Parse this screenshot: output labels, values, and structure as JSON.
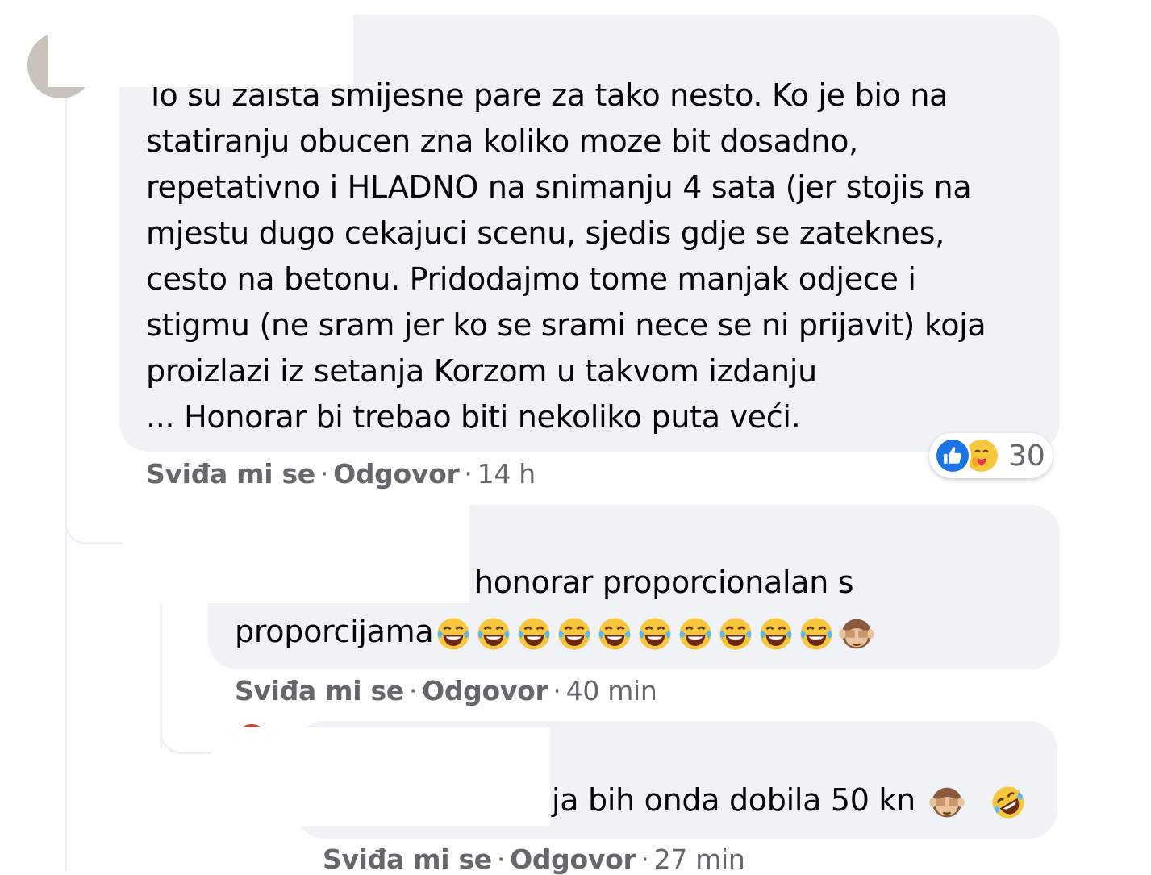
{
  "comment": {
    "lines": [
      "To su zaista smijesne pare za tako nesto. Ko je bio na",
      "statiranju obucen zna koliko moze bit dosadno,",
      "repetativno i HLADNO na snimanju 4 sata (jer stojis na",
      "mjestu dugo cekajuci scenu, sjedis gdje se zateknes,",
      "cesto na betonu. Pridodajmo tome manjak odjece i",
      "stigmu (ne sram jer ko se srami nece se ni prijavit) koja",
      "proizlazi iz setanja Korzom u takvom izdanju",
      "... Honorar bi trebao biti nekoliko puta veći."
    ],
    "like_label": "Sviđa mi se",
    "reply_label": "Odgovor",
    "separator": "·",
    "time": "14 h",
    "reactions": {
      "icons": [
        "like-icon",
        "care-icon"
      ],
      "count": "30"
    }
  },
  "reply1": {
    "line1": "honorar proporcionalan s",
    "line2": "proporcijama",
    "emojis": [
      "laughing-crying-emoji",
      "laughing-crying-emoji",
      "laughing-crying-emoji",
      "laughing-crying-emoji",
      "laughing-crying-emoji",
      "laughing-crying-emoji",
      "laughing-crying-emoji",
      "laughing-crying-emoji",
      "laughing-crying-emoji",
      "laughing-crying-emoji",
      "see-no-evil-monkey-emoji"
    ],
    "like_label": "Sviđa mi se",
    "reply_label": "Odgovor",
    "separator": "·",
    "time": "40 min"
  },
  "reply2": {
    "text": "ja bih onda dobila 50 kn",
    "emojis": [
      "see-no-evil-monkey-emoji",
      "rolling-on-floor-laughing-emoji"
    ],
    "like_label": "Sviđa mi se",
    "reply_label": "Odgovor",
    "separator": "·",
    "time": "27 min"
  },
  "colors": {
    "bubble_bg": "#f0f2f5",
    "meta_text": "#65676b",
    "like_blue": "#1b74e4",
    "emoji_yellow": "#f7c73e"
  }
}
